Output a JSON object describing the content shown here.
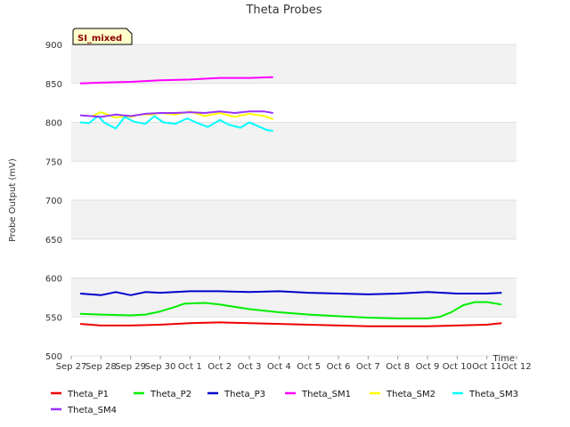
{
  "chart_data": {
    "type": "line",
    "title": "Theta Probes",
    "xlabel": "Time",
    "ylabel": "Probe Output (mV)",
    "ylim": [
      500,
      900
    ],
    "yticks": [
      500,
      550,
      600,
      650,
      700,
      750,
      800,
      850,
      900
    ],
    "xlim": [
      0,
      15
    ],
    "xtick_labels": [
      "Sep 27",
      "Sep 28",
      "Sep 29",
      "Sep 30",
      "Oct 1",
      "Oct 2",
      "Oct 3",
      "Oct 4",
      "Oct 5",
      "Oct 6",
      "Oct 7",
      "Oct 8",
      "Oct 9",
      "Oct 10",
      "Oct 11",
      "Oct 12"
    ],
    "x_unit": "days since Sep 27",
    "badge": "SI_mixed",
    "background_bands": true,
    "legend_position": "bottom",
    "series": [
      {
        "name": "Theta_P1",
        "color": "#ee0000",
        "x": [
          0.3,
          1,
          2,
          3,
          4,
          5,
          6,
          7,
          8,
          9,
          10,
          11,
          12,
          13,
          14,
          14.5
        ],
        "y": [
          541,
          539,
          539,
          540,
          542,
          543,
          542,
          541,
          540,
          539,
          538,
          538,
          538,
          539,
          540,
          542
        ]
      },
      {
        "name": "Theta_P2",
        "color": "#00ee00",
        "x": [
          0.3,
          1,
          2,
          2.5,
          3,
          3.5,
          3.8,
          4.5,
          5,
          6,
          7,
          8,
          9,
          10,
          11,
          12,
          12.4,
          12.8,
          13.2,
          13.6,
          14,
          14.5
        ],
        "y": [
          554,
          553,
          552,
          553,
          557,
          563,
          567,
          568,
          566,
          560,
          556,
          553,
          551,
          549,
          548,
          548,
          550,
          556,
          565,
          569,
          569,
          566
        ]
      },
      {
        "name": "Theta_P3",
        "color": "#0000cc",
        "x": [
          0.3,
          1,
          1.5,
          2,
          2.5,
          3,
          4,
          5,
          6,
          7,
          8,
          9,
          10,
          11,
          12,
          13,
          14,
          14.5
        ],
        "y": [
          580,
          578,
          582,
          578,
          582,
          581,
          583,
          583,
          582,
          583,
          581,
          580,
          579,
          580,
          582,
          580,
          580,
          581
        ]
      },
      {
        "name": "Theta_SM1",
        "color": "#ff00ff",
        "x": [
          0.3,
          1,
          2,
          3,
          4,
          5,
          6,
          6.8
        ],
        "y": [
          850,
          851,
          852,
          854,
          855,
          857,
          857,
          858
        ]
      },
      {
        "name": "Theta_SM2",
        "color": "#ffff00",
        "x": [
          0.7,
          1,
          1.5,
          1.8,
          2,
          2.3,
          2.7,
          3,
          3.5,
          4,
          4.5,
          5,
          5.5,
          6,
          6.5,
          6.8
        ],
        "y": [
          808,
          813,
          806,
          808,
          807,
          810,
          810,
          812,
          810,
          814,
          808,
          812,
          807,
          811,
          808,
          804
        ]
      },
      {
        "name": "Theta_SM3",
        "color": "#00ffff",
        "x": [
          0.3,
          0.6,
          0.9,
          1.1,
          1.5,
          1.8,
          2.1,
          2.5,
          2.8,
          3.1,
          3.5,
          3.9,
          4.2,
          4.6,
          5,
          5.3,
          5.7,
          6,
          6.3,
          6.6,
          6.8
        ],
        "y": [
          800,
          799,
          808,
          800,
          792,
          807,
          801,
          798,
          808,
          800,
          798,
          805,
          800,
          794,
          803,
          797,
          793,
          800,
          795,
          790,
          789
        ]
      },
      {
        "name": "Theta_SM4",
        "color": "#9933ff",
        "x": [
          0.3,
          1,
          1.5,
          2,
          2.5,
          3,
          3.5,
          4,
          4.5,
          5,
          5.5,
          6,
          6.5,
          6.8
        ],
        "y": [
          809,
          807,
          810,
          808,
          811,
          812,
          812,
          813,
          812,
          814,
          812,
          814,
          814,
          812
        ]
      }
    ]
  }
}
